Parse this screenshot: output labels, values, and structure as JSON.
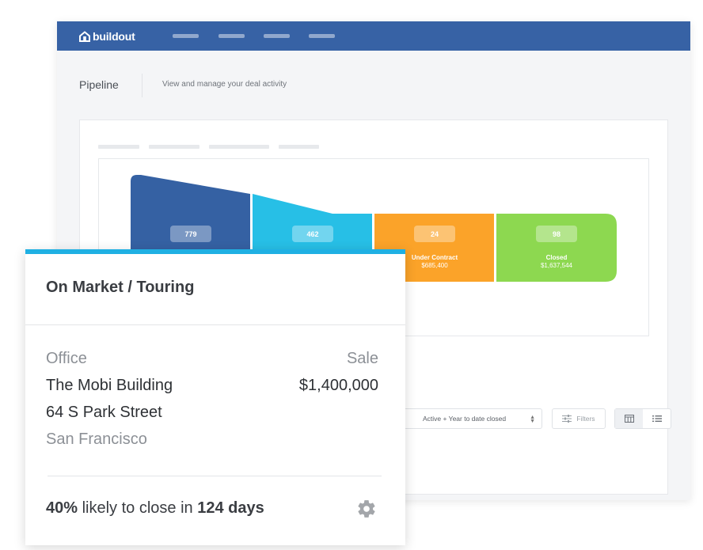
{
  "brand": {
    "name": "buildout"
  },
  "header": {
    "title": "Pipeline",
    "subtitle": "View and manage your deal activity"
  },
  "funnel": [
    {
      "count": "779",
      "label": "",
      "amount": "",
      "color": "#3561a3"
    },
    {
      "count": "462",
      "label": "",
      "amount": "",
      "color": "#27bfe6"
    },
    {
      "count": "24",
      "label": "Under Contract",
      "amount": "$685,400",
      "color": "#fba329"
    },
    {
      "count": "98",
      "label": "Closed",
      "amount": "$1,637,544",
      "color": "#8dd850"
    }
  ],
  "controls": {
    "status_filter": "Active + Year to date closed",
    "filters_label": "Filters"
  },
  "card": {
    "stage_title": "On Market / Touring",
    "property_type": "Office",
    "deal_type": "Sale",
    "property_name": "The Mobi Building",
    "price": "$1,400,000",
    "street": "64 S Park Street",
    "city": "San Francisco",
    "likelihood": "40%",
    "likelihood_text": " likely to close in ",
    "days": "124 days",
    "accent_color": "#1fb0e3"
  },
  "icons": [
    "home-logo-icon",
    "filters-icon",
    "board-view-icon",
    "list-view-icon",
    "gear-icon",
    "select-caret-icon"
  ]
}
